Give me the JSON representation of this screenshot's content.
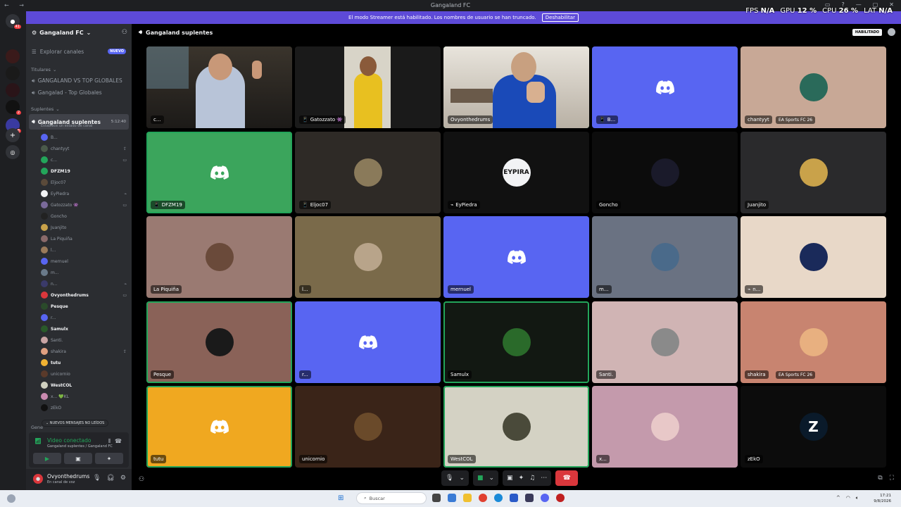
{
  "window": {
    "title": "Gangaland FC",
    "nav": "← →",
    "controls": [
      "—",
      "?",
      "—",
      "▢",
      "✕"
    ]
  },
  "overlay": {
    "fps_label": "FPS",
    "fps_value": "N/A",
    "gpu_label": "GPU",
    "gpu_value": "12 %",
    "cpu_label": "CPU",
    "cpu_value": "26 %",
    "lat_label": "LAT",
    "lat_value": "N/A"
  },
  "banner": {
    "text": "El modo Streamer está habilitado. Los nombres de usuario se han truncado.",
    "button": "Deshabilitar"
  },
  "servers": [
    {
      "icon": "discord-icon",
      "badge": "41"
    },
    {
      "icon": "server-icon",
      "badge": ""
    },
    {
      "icon": "server-icon",
      "badge": ""
    },
    {
      "icon": "server-icon",
      "badge": ""
    },
    {
      "icon": "server-icon",
      "badge": "2"
    },
    {
      "icon": "server-icon",
      "badge": "8"
    },
    {
      "icon": "add-server-icon",
      "badge": ""
    },
    {
      "icon": "discover-icon",
      "badge": ""
    }
  ],
  "sidebar": {
    "guild_name": "Gangaland FC",
    "explore": "Explorar canales",
    "new_tag": "NUEVO",
    "category_titulares": "Titulares",
    "titulares_channels": [
      "GANGALAND VS TOP GLOBALES",
      "Gangalad - Top Globales"
    ],
    "category_suplentes": "Suplentes",
    "active_channel": "Gangaland suplentes",
    "active_time": "5:12:40",
    "active_status": "Establece un estado de canal",
    "category_general_partial": "Gene",
    "unread_pill": "NUEVOS MENSAJES NO LEÍDOS",
    "members": [
      {
        "name": "B...",
        "color": "#5865f2",
        "bright": false,
        "icon": ""
      },
      {
        "name": "chantyyt",
        "color": "#4a5a4a",
        "bright": false,
        "icon": "⇪"
      },
      {
        "name": "c...",
        "color": "#23a55a",
        "bright": false,
        "icon": "▭"
      },
      {
        "name": "DFZM19",
        "color": "#23a55a",
        "bright": true,
        "icon": ""
      },
      {
        "name": "Eljoc07",
        "color": "#5a4a3a",
        "bright": false,
        "icon": ""
      },
      {
        "name": "EyPiedra",
        "color": "#f2f3f5",
        "bright": false,
        "icon": "⌁"
      },
      {
        "name": "Gatozzato 👾",
        "color": "#7a6a9a",
        "bright": false,
        "icon": "▭"
      },
      {
        "name": "Goncho",
        "color": "#222",
        "bright": false,
        "icon": ""
      },
      {
        "name": "Juanjito",
        "color": "#c9a24a",
        "bright": false,
        "icon": ""
      },
      {
        "name": "La Piquiña",
        "color": "#8a6a6a",
        "bright": false,
        "icon": ""
      },
      {
        "name": "l...",
        "color": "#9a7a5a",
        "bright": false,
        "icon": ""
      },
      {
        "name": "mernuel",
        "color": "#5865f2",
        "bright": false,
        "icon": ""
      },
      {
        "name": "m...",
        "color": "#6a7a8a",
        "bright": false,
        "icon": ""
      },
      {
        "name": "n...",
        "color": "#3a3a6a",
        "bright": false,
        "icon": "⌁"
      },
      {
        "name": "Ovyonthedrums",
        "color": "#da373c",
        "bright": true,
        "icon": "▭"
      },
      {
        "name": "Pesque",
        "color": "#2a4a2a",
        "bright": true,
        "icon": ""
      },
      {
        "name": "r...",
        "color": "#5865f2",
        "bright": false,
        "icon": ""
      },
      {
        "name": "Samulx",
        "color": "#2a5a2a",
        "bright": true,
        "icon": ""
      },
      {
        "name": "Santi.",
        "color": "#c9a4a4",
        "bright": false,
        "icon": ""
      },
      {
        "name": "shakira",
        "color": "#e0a080",
        "bright": false,
        "icon": "⇪"
      },
      {
        "name": "tutu",
        "color": "#f0b232",
        "bright": true,
        "icon": ""
      },
      {
        "name": "unicornio",
        "color": "#5a3a2a",
        "bright": false,
        "icon": ""
      },
      {
        "name": "WestCOL",
        "color": "#d0d0c0",
        "bright": true,
        "icon": ""
      },
      {
        "name": "x... 💚KL",
        "color": "#c98ab0",
        "bright": false,
        "icon": ""
      },
      {
        "name": "zEkO",
        "color": "#111",
        "bright": false,
        "icon": ""
      }
    ]
  },
  "voice_panel": {
    "title": "Video conectado",
    "subtitle": "Gangaland suplentes / Gangaland FC"
  },
  "user_panel": {
    "name": "Ovyonthedrums",
    "status": "En canal de voz"
  },
  "main": {
    "channel_name": "Gangaland suplentes",
    "badge": "HABILITADO",
    "tiles": [
      {
        "label": "c...",
        "bg": "#2a2622",
        "type": "video",
        "speaking": false,
        "icon": "",
        "activity": ""
      },
      {
        "label": "Gatozzato 👾",
        "bg": "#1a1a1a",
        "type": "video2",
        "speaking": false,
        "icon": "📱",
        "activity": ""
      },
      {
        "label": "Ovyonthedrums",
        "bg": "#d8d4cc",
        "type": "video3",
        "speaking": true,
        "icon": "",
        "activity": ""
      },
      {
        "label": "B...",
        "bg": "#5865f2",
        "type": "logo",
        "speaking": false,
        "icon": "📱",
        "activity": ""
      },
      {
        "label": "chantyyt",
        "bg": "#c8a896",
        "type": "avatar",
        "avcolor": "#2a6a5a",
        "speaking": false,
        "icon": "",
        "activity": "EA Sports FC 26"
      },
      {
        "label": "DFZM19",
        "bg": "#3ba55c",
        "type": "logo",
        "speaking": true,
        "icon": "📱",
        "activity": ""
      },
      {
        "label": "Eljoc07",
        "bg": "#2e2a26",
        "type": "avatar",
        "avcolor": "#8a7a5a",
        "speaking": false,
        "icon": "📱",
        "activity": ""
      },
      {
        "label": "EyPiedra",
        "bg": "#111111",
        "type": "avatar",
        "avcolor": "#f2f3f5",
        "speaking": false,
        "icon": "⌁",
        "activity": "",
        "avtext": "EYPIRA"
      },
      {
        "label": "Goncho",
        "bg": "#0c0c0c",
        "type": "avatar",
        "avcolor": "#1a1a2a",
        "speaking": false,
        "icon": "",
        "activity": ""
      },
      {
        "label": "Juanjito",
        "bg": "#2a2a2c",
        "type": "avatar",
        "avcolor": "#c9a24a",
        "speaking": false,
        "icon": "",
        "activity": ""
      },
      {
        "label": "La Piquiña",
        "bg": "#9a7a72",
        "type": "avatar",
        "avcolor": "#6a4a3a",
        "speaking": false,
        "icon": "",
        "activity": ""
      },
      {
        "label": "l...",
        "bg": "#7a6a4a",
        "type": "avatar",
        "avcolor": "#b8a48a",
        "speaking": false,
        "icon": "",
        "activity": ""
      },
      {
        "label": "mernuel",
        "bg": "#5865f2",
        "type": "logo",
        "speaking": false,
        "icon": "",
        "activity": ""
      },
      {
        "label": "m...",
        "bg": "#6a7282",
        "type": "avatar",
        "avcolor": "#4a6a8a",
        "speaking": false,
        "icon": "",
        "activity": ""
      },
      {
        "label": "n...",
        "bg": "#e8d8c8",
        "type": "avatar",
        "avcolor": "#1a2a5a",
        "speaking": false,
        "icon": "⌁",
        "activity": ""
      },
      {
        "label": "Pesque",
        "bg": "#8a6258",
        "type": "avatar",
        "avcolor": "#1a1a1a",
        "speaking": true,
        "icon": "",
        "activity": ""
      },
      {
        "label": "r...",
        "bg": "#5865f2",
        "type": "logo",
        "speaking": false,
        "icon": "",
        "activity": ""
      },
      {
        "label": "Samulx",
        "bg": "#121812",
        "type": "avatar",
        "avcolor": "#2a6a2a",
        "speaking": true,
        "icon": "",
        "activity": ""
      },
      {
        "label": "Santi.",
        "bg": "#d0b4b4",
        "type": "avatar",
        "avcolor": "#8a8a8a",
        "speaking": false,
        "icon": "",
        "activity": ""
      },
      {
        "label": "shakira",
        "bg": "#c88470",
        "type": "avatar",
        "avcolor": "#e8b080",
        "speaking": false,
        "icon": "",
        "activity": "EA Sports FC 26"
      },
      {
        "label": "tutu",
        "bg": "#f0a820",
        "type": "logo",
        "speaking": true,
        "icon": "",
        "activity": ""
      },
      {
        "label": "unicornio",
        "bg": "#3a2418",
        "type": "avatar",
        "avcolor": "#6a4a2a",
        "speaking": false,
        "icon": "",
        "activity": ""
      },
      {
        "label": "WestCOL",
        "bg": "#d4d2c4",
        "type": "avatar",
        "avcolor": "#4a4a3a",
        "speaking": true,
        "icon": "",
        "activity": ""
      },
      {
        "label": "x...",
        "bg": "#c49aac",
        "type": "avatar",
        "avcolor": "#e8c8c8",
        "speaking": false,
        "icon": "",
        "activity": ""
      },
      {
        "label": "zEkO",
        "bg": "#0c0c0c",
        "type": "avatar",
        "avcolor": "#0a1a2a",
        "speaking": false,
        "icon": "",
        "activity": "",
        "avtext": "Z"
      }
    ]
  },
  "taskbar": {
    "search_placeholder": "Buscar",
    "time": "17:21",
    "date": "9/8/2026"
  }
}
